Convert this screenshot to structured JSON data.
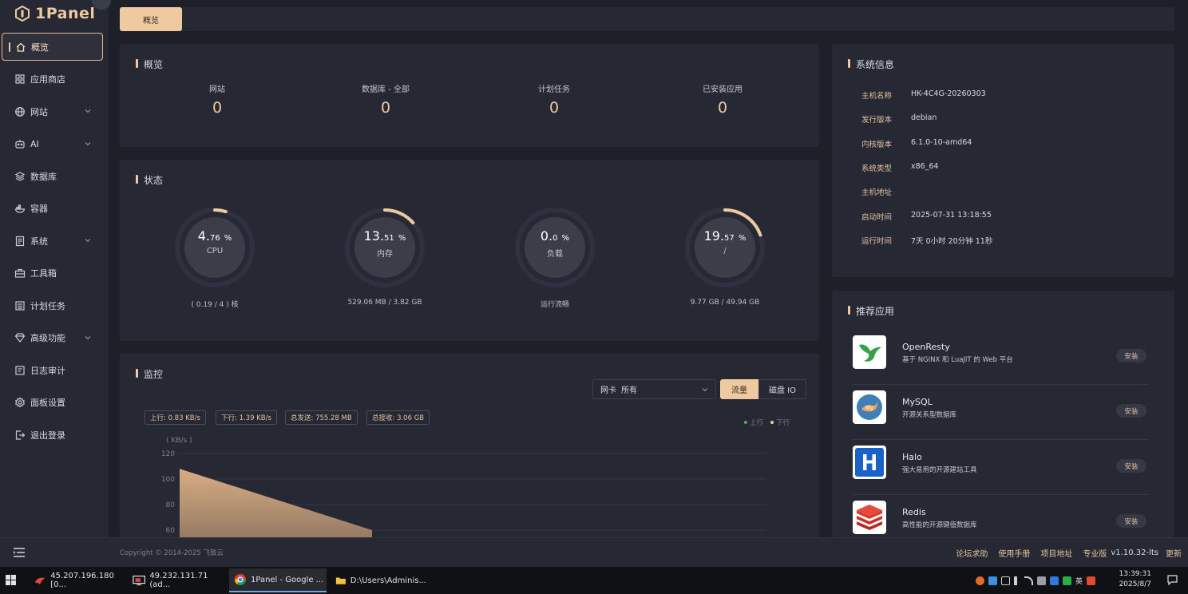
{
  "brand": {
    "name": "1Panel"
  },
  "sidebar": {
    "items": [
      {
        "label": "概览",
        "icon": "home-icon"
      },
      {
        "label": "应用商店",
        "icon": "grid-icon"
      },
      {
        "label": "网站",
        "icon": "globe-icon"
      },
      {
        "label": "AI",
        "icon": "robot-icon"
      },
      {
        "label": "数据库",
        "icon": "database-icon"
      },
      {
        "label": "容器",
        "icon": "container-icon"
      },
      {
        "label": "系统",
        "icon": "system-icon"
      },
      {
        "label": "工具箱",
        "icon": "toolbox-icon"
      },
      {
        "label": "计划任务",
        "icon": "cron-icon"
      },
      {
        "label": "高级功能",
        "icon": "diamond-icon"
      },
      {
        "label": "日志审计",
        "icon": "log-icon"
      },
      {
        "label": "面板设置",
        "icon": "settings-icon"
      },
      {
        "label": "退出登录",
        "icon": "logout-icon"
      }
    ]
  },
  "tabs": {
    "active": "概览"
  },
  "overview": {
    "title": "概览",
    "items": [
      {
        "label": "网站",
        "value": "0"
      },
      {
        "label": "数据库 - 全部",
        "value": "0"
      },
      {
        "label": "计划任务",
        "value": "0"
      },
      {
        "label": "已安装应用",
        "value": "0"
      }
    ]
  },
  "status": {
    "title": "状态",
    "gauges": [
      {
        "int": "4.",
        "dec": "76",
        "unit": "%",
        "label": "CPU",
        "sub": "( 0.19 / 4 ) 核",
        "percent": 4.76
      },
      {
        "int": "13.",
        "dec": "51",
        "unit": "%",
        "label": "内存",
        "sub": "529.06 MB / 3.82 GB",
        "percent": 13.51
      },
      {
        "int": "0.",
        "dec": "0",
        "unit": "%",
        "label": "负载",
        "sub": "运行流畅",
        "percent": 0
      },
      {
        "int": "19.",
        "dec": "57",
        "unit": "%",
        "label": "/",
        "sub": "9.77 GB / 49.94 GB",
        "percent": 19.57
      }
    ]
  },
  "monitor": {
    "title": "监控",
    "nic_label": "网卡",
    "nic_value": "所有",
    "seg_traffic": "流量",
    "seg_disk": "磁盘 IO",
    "chips": [
      "上行: 0.83 KB/s",
      "下行: 1.39 KB/s",
      "总发送: 755.28 MB",
      "总接收: 3.06 GB"
    ],
    "legend_up": "上行",
    "legend_down": "下行",
    "legend_up_color": "#4caf50",
    "legend_down_color": "#efc9a0"
  },
  "chart_data": {
    "type": "area",
    "ylabel": "( KB/s )",
    "y_ticks": [
      120,
      100,
      80,
      60
    ],
    "ylim": [
      60,
      120
    ],
    "series": [
      {
        "name": "下行",
        "values": [
          108,
          60
        ]
      }
    ],
    "grid": true,
    "legend": "top-right"
  },
  "sysinfo": {
    "title": "系统信息",
    "rows": [
      {
        "key": "主机名称",
        "value": "HK-4C4G-20260303"
      },
      {
        "key": "发行版本",
        "value": "debian"
      },
      {
        "key": "内核版本",
        "value": "6.1.0-10-amd64"
      },
      {
        "key": "系统类型",
        "value": "x86_64"
      },
      {
        "key": "主机地址",
        "value": ""
      },
      {
        "key": "启动时间",
        "value": "2025-07-31 13:18:55"
      },
      {
        "key": "运行时间",
        "value": "7天 0小时 20分钟 11秒"
      }
    ]
  },
  "apps": {
    "title": "推荐应用",
    "install_label": "安装",
    "items": [
      {
        "name": "OpenResty",
        "desc": "基于 NGINX 和 LuaJIT 的 Web 平台",
        "icon": "openresty-logo"
      },
      {
        "name": "MySQL",
        "desc": "开源关系型数据库",
        "icon": "mysql-logo"
      },
      {
        "name": "Halo",
        "desc": "强大易用的开源建站工具",
        "icon": "halo-logo"
      },
      {
        "name": "Redis",
        "desc": "高性能的开源键值数据库",
        "icon": "redis-logo"
      }
    ]
  },
  "footer": {
    "copyright": "Copyright © 2014-2025 飞致云",
    "links": [
      "论坛求助",
      "使用手册",
      "项目地址"
    ],
    "edition": "专业版",
    "version": "v1.10.32-lts",
    "update": "更新"
  },
  "taskbar": {
    "tasks": [
      "45.207.196.180 [0...",
      "49.232.131.71 (ad...",
      "1Panel - Google ...",
      "D:\\Users\\Adminis..."
    ],
    "ime": "英",
    "time": "13:39:31",
    "date": "2025/8/7"
  },
  "colors": {
    "accent": "#efc9a0",
    "bg": "#1d1f29",
    "card": "#262834"
  }
}
